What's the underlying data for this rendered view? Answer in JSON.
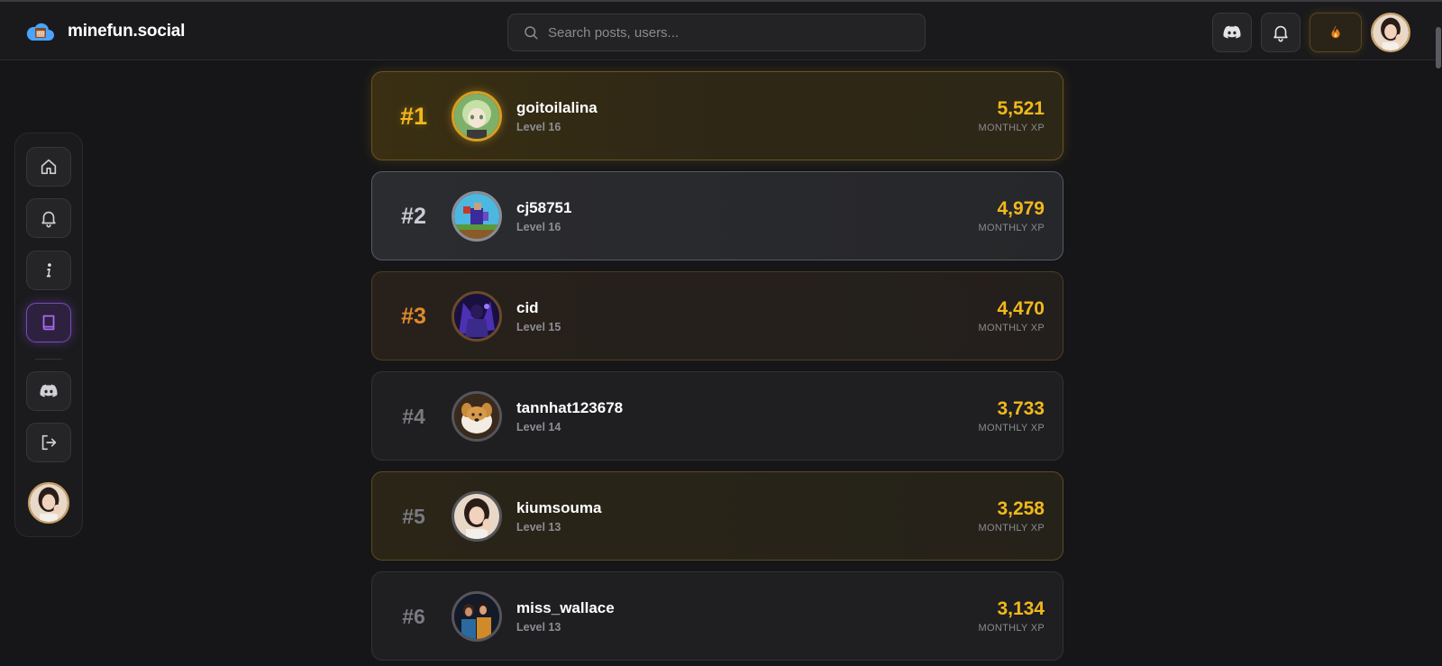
{
  "header": {
    "brand": "minefun.social",
    "search_placeholder": "Search posts, users...",
    "actions": [
      {
        "name": "discord-icon"
      },
      {
        "name": "bell-icon"
      },
      {
        "name": "fire-icon"
      }
    ]
  },
  "sidebar": {
    "items": [
      {
        "name": "home-icon"
      },
      {
        "name": "bell-icon"
      },
      {
        "name": "info-icon"
      },
      {
        "name": "book-icon",
        "active": true
      },
      {
        "name": "discord-icon"
      },
      {
        "name": "logout-icon"
      }
    ]
  },
  "leaderboard": {
    "xp_label": "MONTHLY XP",
    "entries": [
      {
        "rank": "#1",
        "username": "goitoilalina",
        "level": "Level 16",
        "xp": "5,521"
      },
      {
        "rank": "#2",
        "username": "cj58751",
        "level": "Level 16",
        "xp": "4,979"
      },
      {
        "rank": "#3",
        "username": "cid",
        "level": "Level 15",
        "xp": "4,470"
      },
      {
        "rank": "#4",
        "username": "tannhat123678",
        "level": "Level 14",
        "xp": "3,733"
      },
      {
        "rank": "#5",
        "username": "kiumsouma",
        "level": "Level 13",
        "xp": "3,258"
      },
      {
        "rank": "#6",
        "username": "miss_wallace",
        "level": "Level 13",
        "xp": "3,134"
      }
    ]
  },
  "colors": {
    "background": "#161618",
    "gold": "#f2b81c",
    "silver": "#c9ccd3",
    "bronze": "#e08a2c",
    "active_purple": "#7a4ab8"
  }
}
